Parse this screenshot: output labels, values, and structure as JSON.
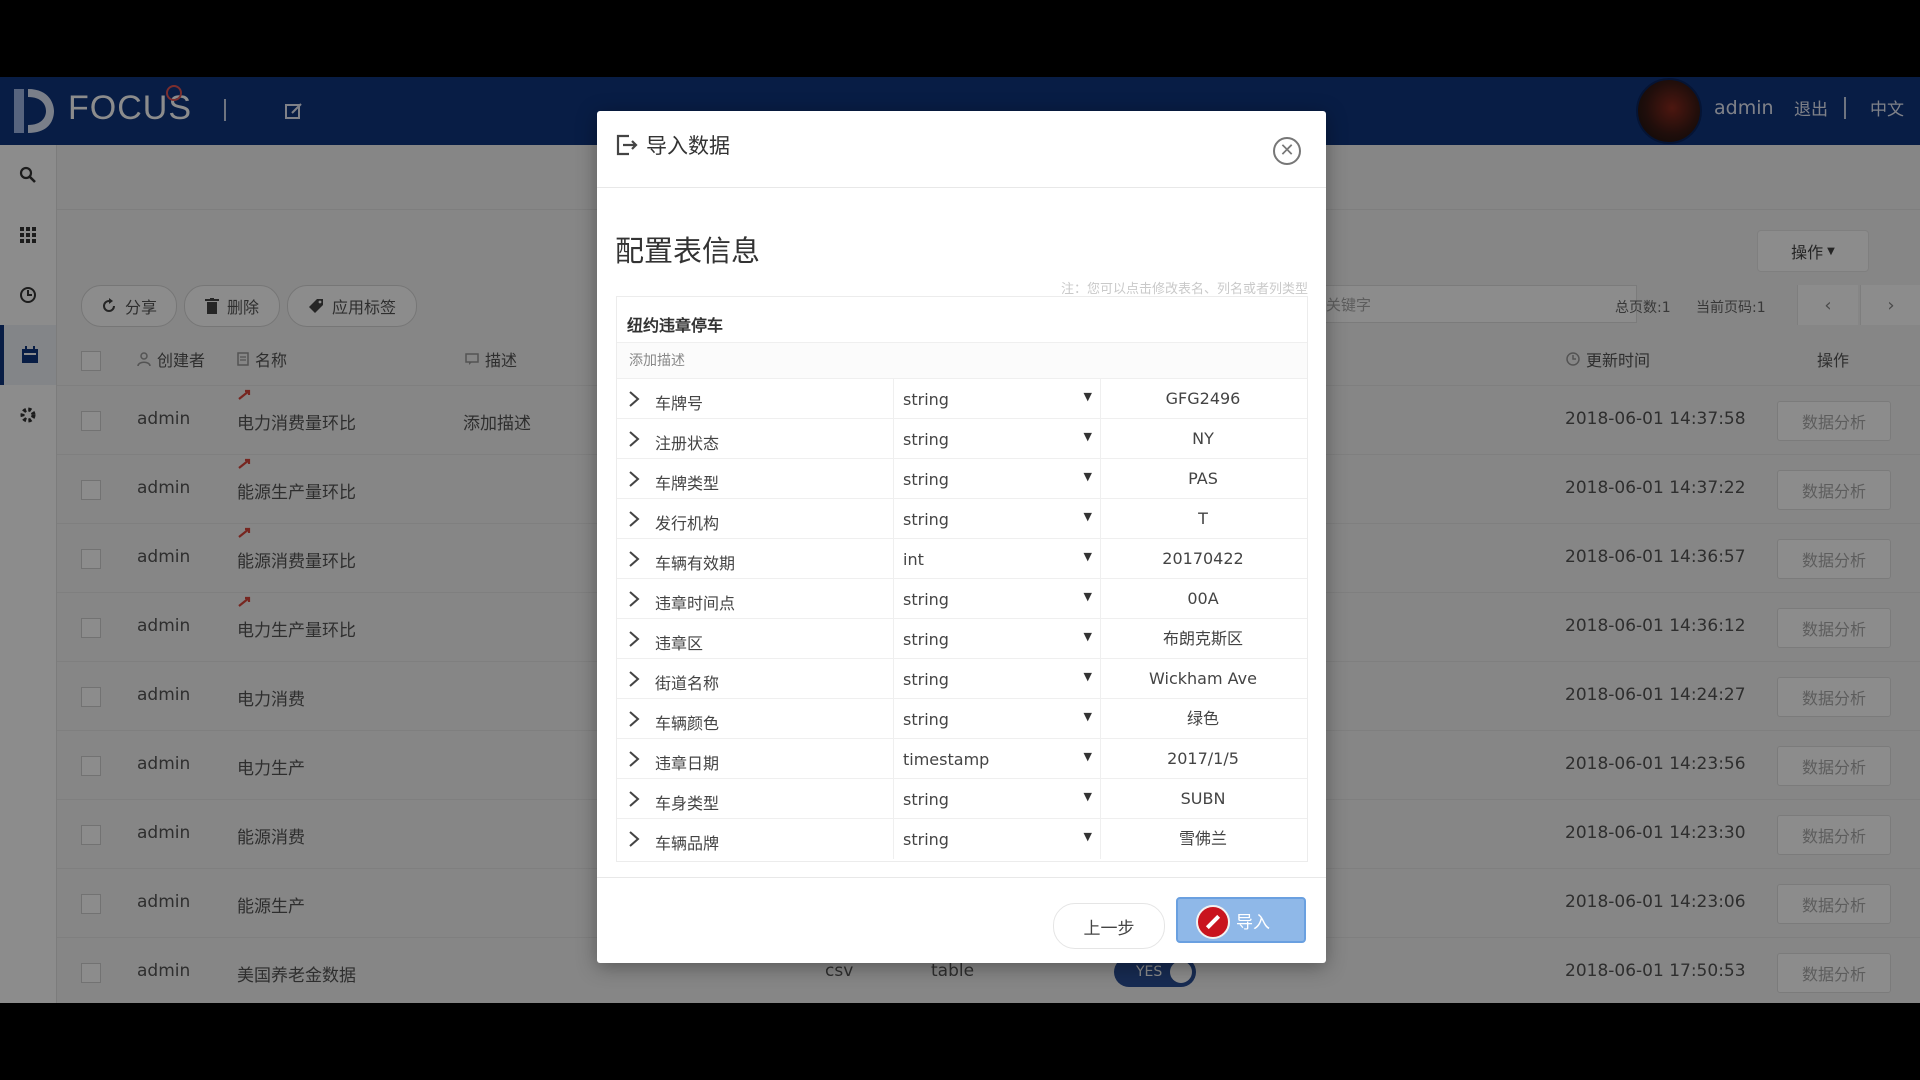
{
  "header": {
    "brand": "FOCUS",
    "user": "admin",
    "logout": "退出",
    "language": "中文"
  },
  "toolbar": {
    "share": "分享",
    "delete": "删除",
    "apply_tag": "应用标签",
    "operations": "操作",
    "search_placeholder": "关键字",
    "total_pages": "总页数:1",
    "current_page": "当前页码:1"
  },
  "table": {
    "headers": {
      "creator": "创建者",
      "name": "名称",
      "description": "描述",
      "updated_time": "更新时间",
      "actions": "操作"
    },
    "rows": [
      {
        "creator": "admin",
        "name": "电力消费量环比",
        "desc": "添加描述",
        "time": "2018-06-01 14:37:58",
        "action": "数据分析"
      },
      {
        "creator": "admin",
        "name": "能源生产量环比",
        "desc": "",
        "time": "2018-06-01 14:37:22",
        "action": "数据分析"
      },
      {
        "creator": "admin",
        "name": "能源消费量环比",
        "desc": "",
        "time": "2018-06-01 14:36:57",
        "action": "数据分析"
      },
      {
        "creator": "admin",
        "name": "电力生产量环比",
        "desc": "",
        "time": "2018-06-01 14:36:12",
        "action": "数据分析"
      },
      {
        "creator": "admin",
        "name": "电力消费",
        "desc": "",
        "time": "2018-06-01 14:24:27",
        "action": "数据分析"
      },
      {
        "creator": "admin",
        "name": "电力生产",
        "desc": "",
        "time": "2018-06-01 14:23:56",
        "action": "数据分析"
      },
      {
        "creator": "admin",
        "name": "能源消费",
        "desc": "",
        "time": "2018-06-01 14:23:30",
        "action": "数据分析"
      },
      {
        "creator": "admin",
        "name": "能源生产",
        "desc": "",
        "time": "2018-06-01 14:23:06",
        "action": "数据分析"
      },
      {
        "creator": "admin",
        "name": "美国养老金数据",
        "desc": "",
        "time": "2018-06-01 17:50:53",
        "action": "数据分析",
        "format": "csv",
        "type": "table",
        "toggle": "YES"
      }
    ]
  },
  "modal": {
    "title": "导入数据",
    "section_title": "配置表信息",
    "note": "注：您可以点击修改表名、列名或者列类型",
    "table_name": "纽约违章停车",
    "add_description": "添加描述",
    "fields": [
      {
        "name": "车牌号",
        "type": "string",
        "sample": "GFG2496"
      },
      {
        "name": "注册状态",
        "type": "string",
        "sample": "NY"
      },
      {
        "name": "车牌类型",
        "type": "string",
        "sample": "PAS"
      },
      {
        "name": "发行机构",
        "type": "string",
        "sample": "T"
      },
      {
        "name": "车辆有效期",
        "type": "int",
        "sample": "20170422"
      },
      {
        "name": "违章时间点",
        "type": "string",
        "sample": "00A"
      },
      {
        "name": "违章区",
        "type": "string",
        "sample": "布朗克斯区"
      },
      {
        "name": "街道名称",
        "type": "string",
        "sample": "Wickham Ave"
      },
      {
        "name": "车辆颜色",
        "type": "string",
        "sample": "绿色"
      },
      {
        "name": "违章日期",
        "type": "timestamp",
        "sample": "2017/1/5"
      },
      {
        "name": "车身类型",
        "type": "string",
        "sample": "SUBN"
      },
      {
        "name": "车辆品牌",
        "type": "string",
        "sample": "雪佛兰"
      }
    ],
    "btn_prev": "上一步",
    "btn_import": "导入"
  },
  "colors": {
    "header_bg": "#10357f",
    "import_button": "#8fb8e8",
    "toggle": "#2a4f96"
  }
}
